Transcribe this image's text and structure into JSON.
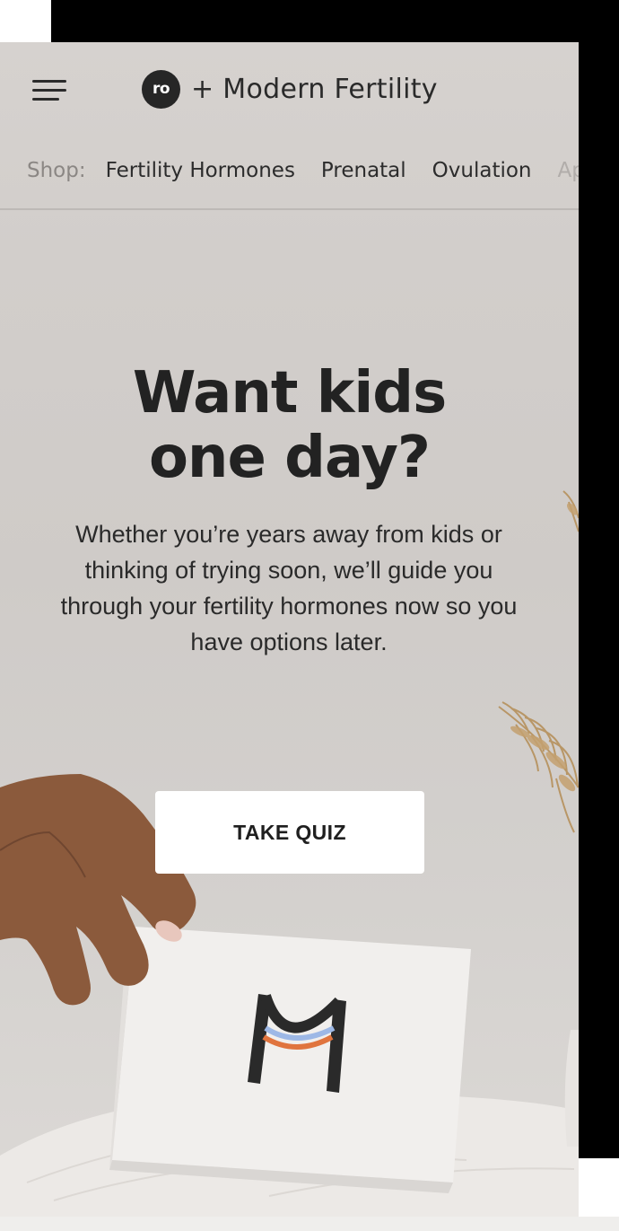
{
  "header": {
    "menu_icon": "hamburger-menu-icon",
    "badge_text": "ro",
    "brand_text": "+ Modern Fertility"
  },
  "shop_nav": {
    "label": "Shop:",
    "links": [
      "Fertility Hormones",
      "Prenatal",
      "Ovulation",
      "App"
    ]
  },
  "hero": {
    "title_line1": "Want kids",
    "title_line2": "one day?",
    "subtitle": "Whether you’re years away from kids or thinking of trying soon, we’ll guide you through your fertility hormones now so you have options later.",
    "cta_label": "TAKE QUIZ"
  },
  "colors": {
    "background": "#d2cecb",
    "text": "#222222",
    "cta_background": "#ffffff",
    "badge": "#262626"
  }
}
